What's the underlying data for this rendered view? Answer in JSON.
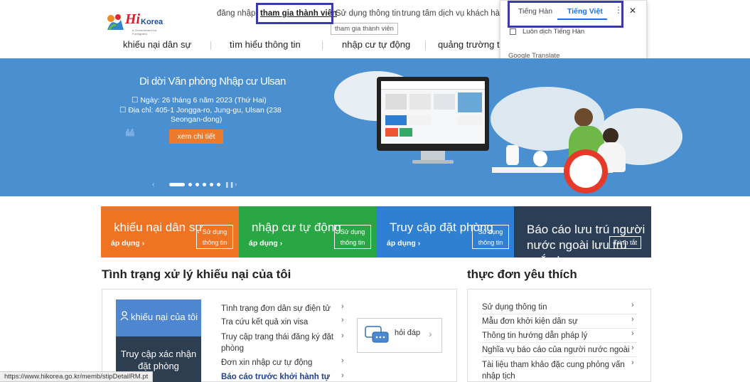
{
  "logo": {
    "word_a": "Hi",
    "word_b": "Korea",
    "tagline": "e-Government for Foreigners"
  },
  "util_nav": {
    "items": [
      "đăng nhập",
      "tham gia thành viên",
      "Sử dụng thông tin",
      "trung tâm dịch vụ khách hàng"
    ],
    "active_index": 1,
    "tooltip": "tham gia thành viên"
  },
  "main_nav": [
    "khiếu nại dân sự",
    "tìm hiểu thông tin",
    "nhập cư tự động",
    "quảng trường t"
  ],
  "translate": {
    "tab_source": "Tiếng Hàn",
    "tab_target": "Tiếng Việt",
    "always": "Luôn dịch Tiếng Hàn",
    "brand": "Google Translate",
    "accent": "#1a73e8"
  },
  "banner": {
    "title": "Di dời Văn phòng Nhập cư Ulsan",
    "date_line": "Ngày: 26 tháng 6 năm 2023 (Thứ Hai)",
    "address_line1": "Địa chỉ: 405-1 Jongga-ro, Jung-gu, Ulsan (238",
    "address_line2": "Seongan-dong)",
    "button": "xem chi tiết",
    "slide_count": 7,
    "active_slide": 1,
    "bg_color": "#4a8fd0"
  },
  "tiles": [
    {
      "title": "khiếu nại dân sự",
      "action": "áp dụng",
      "box_line1": "Sử dụng",
      "box_line2": "thông tin",
      "color": "#ee7322"
    },
    {
      "title": "nhập cư tự động",
      "action": "áp dụng",
      "box_line1": "Sử dụng",
      "box_line2": "thông tin",
      "color": "#2aa745"
    },
    {
      "title": "Truy cập đặt phòng",
      "action": "áp dụng",
      "box_line1": "Sử dụng",
      "box_line2": "thông tin",
      "color": "#2f7fd2"
    },
    {
      "title": "Báo cáo lưu trú người nước ngoài lưu trú ngắn hạn",
      "box_line1": "Trình tắt",
      "color": "#2b3e56"
    }
  ],
  "status_section": {
    "heading": "Tình trạng xử lý khiếu nại của tôi",
    "my_complaints": "khiếu nại của tôi",
    "reservation": "Truy cập xác nhận đặt phòng",
    "items": [
      "Tình trạng đơn dân sự điện tử",
      "Tra cứu kết quả xin visa",
      "Truy cập trạng thái đăng ký đặt phòng",
      "Đơn xin nhập cư tự động",
      "Báo cáo trước khởi hành tự"
    ],
    "qa": "hỏi đáp"
  },
  "favorites": {
    "heading": "thực đơn yêu thích",
    "items": [
      "Sử dụng thông tin",
      "Mẫu đơn khởi kiện dân sự",
      "Thông tin hướng dẫn pháp lý",
      "Nghĩa vụ báo cáo của người nước ngoài",
      "Tài liệu tham khảo đặc cung phỏng vấn nhập tịch"
    ]
  },
  "status_bar": "https://www.hikorea.go.kr/memb/stipDetailRM.pt"
}
